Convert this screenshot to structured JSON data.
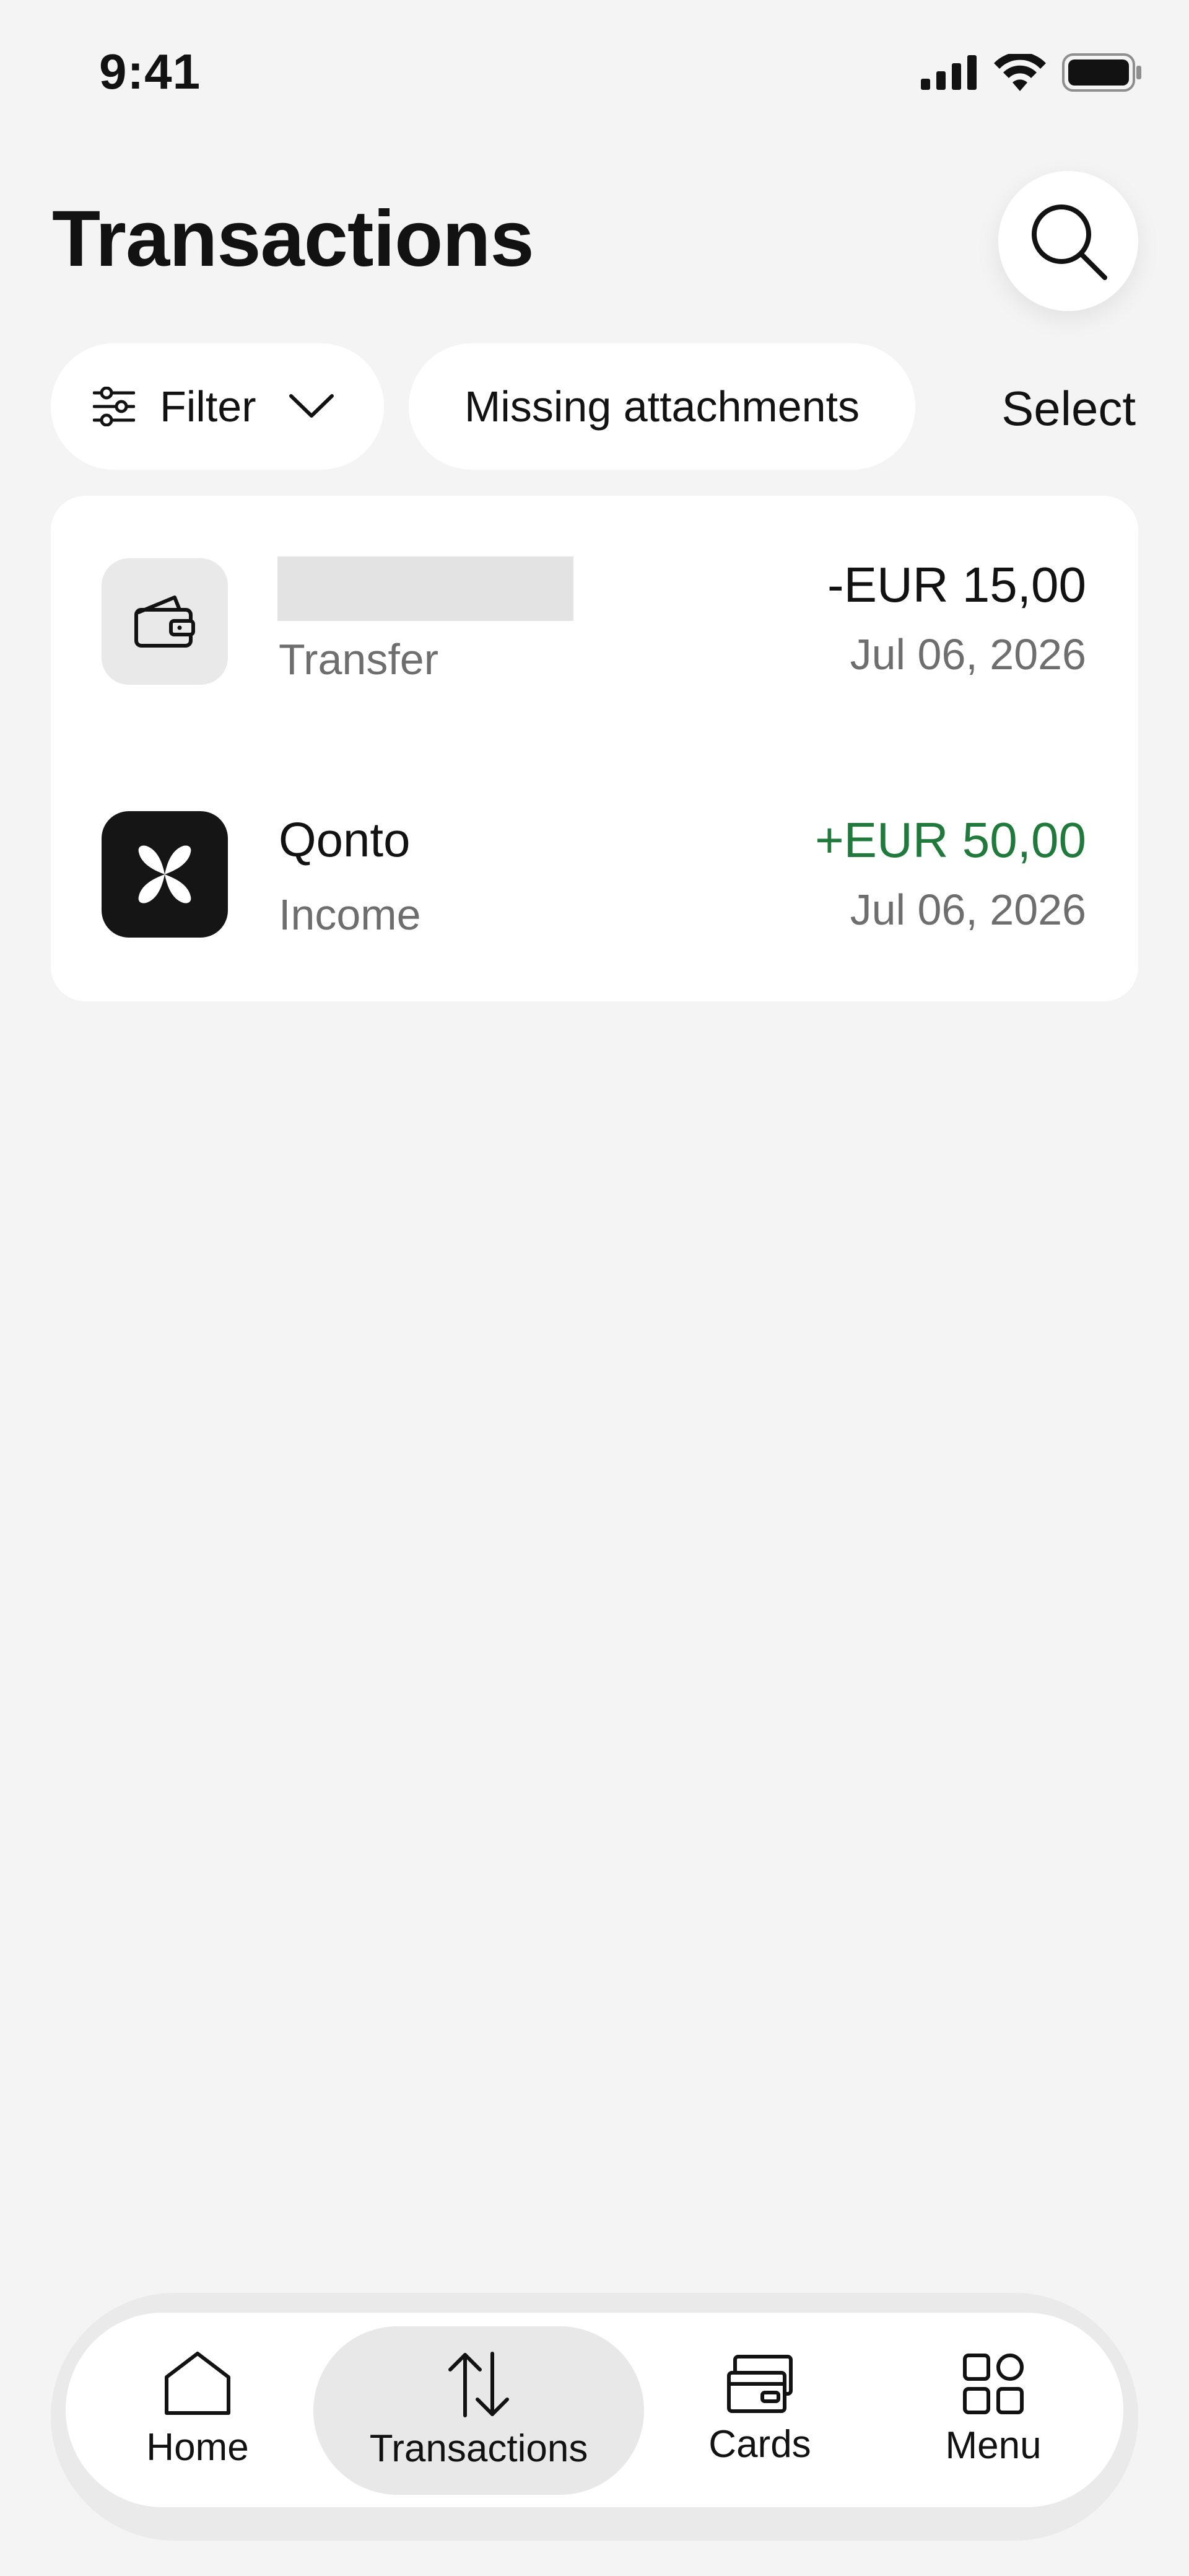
{
  "status_bar": {
    "time": "9:41"
  },
  "header": {
    "title": "Transactions",
    "search_icon": "search-icon"
  },
  "filters": {
    "filter_label": "Filter",
    "missing_attachments_label": "Missing attachments",
    "select_label": "Select"
  },
  "transactions": [
    {
      "name": "",
      "type": "Transfer",
      "amount": "-EUR 15,00",
      "date": "Jul 06, 2026",
      "icon": "wallet-icon"
    },
    {
      "name": "Qonto",
      "type": "Income",
      "amount": "+EUR 50,00",
      "date": "Jul 06, 2026",
      "icon": "qonto-logo"
    }
  ],
  "tabbar": {
    "items": [
      {
        "label": "Home",
        "icon": "home-icon"
      },
      {
        "label": "Transactions",
        "icon": "transfer-arrows-icon"
      },
      {
        "label": "Cards",
        "icon": "cards-icon"
      },
      {
        "label": "Menu",
        "icon": "grid-icon"
      }
    ],
    "active": "Transactions"
  },
  "colors": {
    "background": "#f3f4f3",
    "positive_amount": "#1f7a3b",
    "secondary_text": "#6e6e6e"
  }
}
